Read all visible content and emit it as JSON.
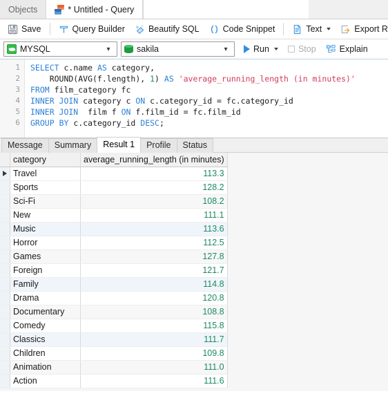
{
  "window": {
    "tabs": [
      {
        "label": "Objects",
        "active": false,
        "icon": null
      },
      {
        "label": "* Untitled - Query",
        "active": true,
        "icon": "query-document-icon"
      }
    ]
  },
  "toolbar": {
    "items": [
      {
        "label": "Save",
        "icon": "save-disk-icon",
        "dropdown": false
      },
      {
        "label": "Query Builder",
        "icon": "query-builder-icon",
        "dropdown": false
      },
      {
        "label": "Beautify SQL",
        "icon": "beautify-sql-icon",
        "dropdown": false
      },
      {
        "label": "Code Snippet",
        "icon": "code-snippet-icon",
        "dropdown": false
      },
      {
        "label": "Text",
        "icon": "text-document-icon",
        "dropdown": true
      },
      {
        "label": "Export Result",
        "icon": "export-result-icon",
        "dropdown": false
      },
      {
        "label": "",
        "icon": "chart-bars-icon",
        "dropdown": false
      }
    ]
  },
  "connection": {
    "server": {
      "value": "MYSQL",
      "icon": "mysql-dolphin-icon"
    },
    "database": {
      "value": "sakila",
      "icon": "database-cylinder-icon"
    },
    "run": {
      "label": "Run",
      "icon": "play-triangle-icon",
      "enabled": true,
      "dropdown": true
    },
    "stop": {
      "label": "Stop",
      "icon": "stop-square-icon",
      "enabled": false
    },
    "explain": {
      "label": "Explain",
      "icon": "explain-tree-icon",
      "enabled": true
    }
  },
  "editor": {
    "line_numbers": [
      "1",
      "2",
      "3",
      "4",
      "5",
      "6"
    ],
    "lines": [
      [
        {
          "t": "SELECT",
          "c": "kw"
        },
        {
          "t": " c.name ",
          "c": "pln"
        },
        {
          "t": "AS",
          "c": "kw"
        },
        {
          "t": " category,",
          "c": "pln"
        }
      ],
      [
        {
          "t": "    ROUND(AVG(f.length), ",
          "c": "pln"
        },
        {
          "t": "1",
          "c": "num"
        },
        {
          "t": ") ",
          "c": "pln"
        },
        {
          "t": "AS",
          "c": "kw"
        },
        {
          "t": " ",
          "c": "pln"
        },
        {
          "t": "'average_running_length (in minutes)'",
          "c": "str"
        }
      ],
      [
        {
          "t": "FROM",
          "c": "kw"
        },
        {
          "t": " film_category fc",
          "c": "pln"
        }
      ],
      [
        {
          "t": "INNER JOIN",
          "c": "kw"
        },
        {
          "t": " category c ",
          "c": "pln"
        },
        {
          "t": "ON",
          "c": "kw"
        },
        {
          "t": " c.category_id = fc.category_id",
          "c": "pln"
        }
      ],
      [
        {
          "t": "INNER JOIN",
          "c": "kw"
        },
        {
          "t": "  film f ",
          "c": "pln"
        },
        {
          "t": "ON",
          "c": "kw"
        },
        {
          "t": " f.film_id = fc.film_id",
          "c": "pln"
        }
      ],
      [
        {
          "t": "GROUP",
          "c": "kw"
        },
        {
          "t": " ",
          "c": "pln"
        },
        {
          "t": "BY",
          "c": "kw"
        },
        {
          "t": " c.category_id ",
          "c": "pln"
        },
        {
          "t": "DESC",
          "c": "kw"
        },
        {
          "t": ";",
          "c": "pln"
        }
      ]
    ],
    "plain_text": "SELECT c.name AS category,\n    ROUND(AVG(f.length), 1) AS 'average_running_length (in minutes)'\nFROM film_category fc\nINNER JOIN category c ON c.category_id = fc.category_id\nINNER JOIN  film f ON f.film_id = fc.film_id\nGROUP BY c.category_id DESC;"
  },
  "result_tabs": {
    "items": [
      "Message",
      "Summary",
      "Result 1",
      "Profile",
      "Status"
    ],
    "selected": "Result 1"
  },
  "result_grid": {
    "columns": [
      "category",
      "average_running_length (in minutes)"
    ],
    "selected_row_index": 0,
    "rows": [
      {
        "category": "Travel",
        "average": "113.3"
      },
      {
        "category": "Sports",
        "average": "128.2"
      },
      {
        "category": "Sci-Fi",
        "average": "108.2"
      },
      {
        "category": "New",
        "average": "111.1"
      },
      {
        "category": "Music",
        "average": "113.6"
      },
      {
        "category": "Horror",
        "average": "112.5"
      },
      {
        "category": "Games",
        "average": "127.8"
      },
      {
        "category": "Foreign",
        "average": "121.7"
      },
      {
        "category": "Family",
        "average": "114.8"
      },
      {
        "category": "Drama",
        "average": "120.8"
      },
      {
        "category": "Documentary",
        "average": "108.8"
      },
      {
        "category": "Comedy",
        "average": "115.8"
      },
      {
        "category": "Classics",
        "average": "111.7"
      },
      {
        "category": "Children",
        "average": "109.8"
      },
      {
        "category": "Animation",
        "average": "111.0"
      },
      {
        "category": "Action",
        "average": "111.6"
      }
    ]
  },
  "colors": {
    "accent_blue": "#2f8fe0",
    "keyword_blue": "#2b7fd4",
    "string_red": "#d23b5a",
    "number_green": "#1d8a62",
    "selection_blue": "#eef3f8",
    "row_alt_gray": "#f7f7f7",
    "row_alt_blue": "#eff5fa"
  }
}
